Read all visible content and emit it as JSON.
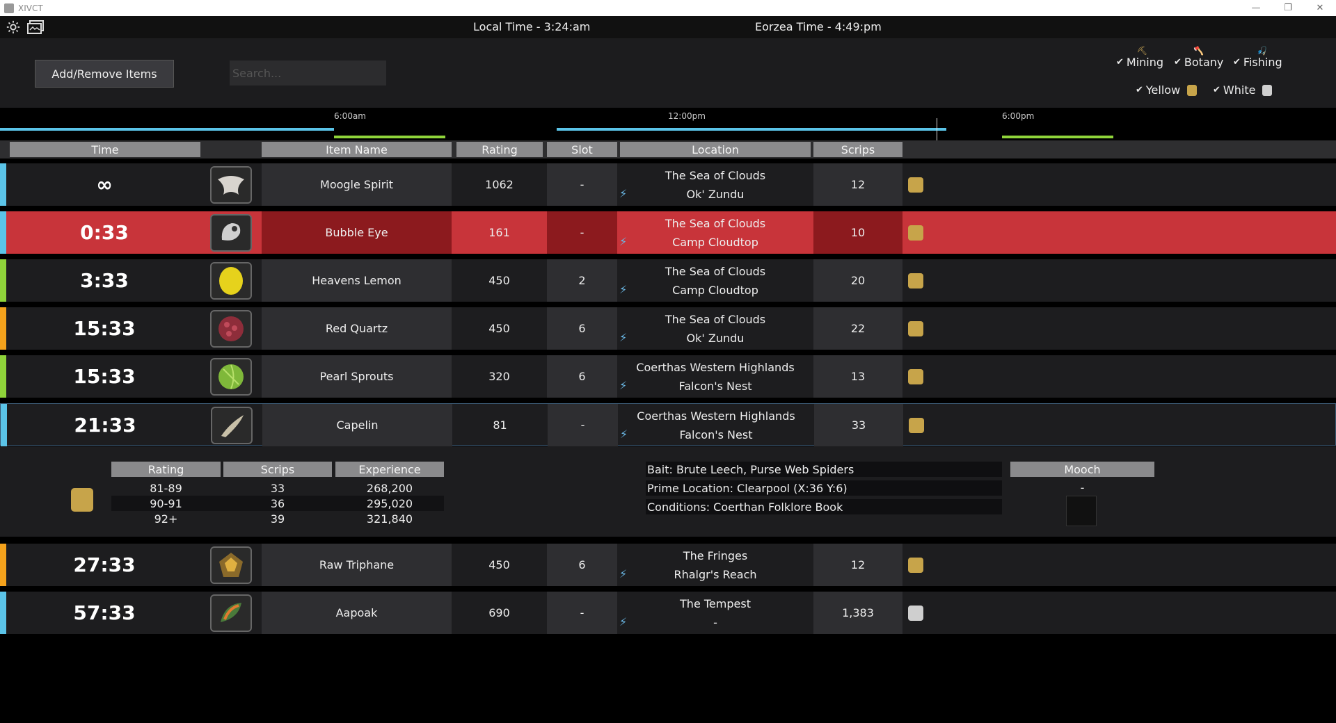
{
  "window": {
    "title": "XIVCT",
    "minimize": "—",
    "restore": "❐",
    "close": "✕"
  },
  "topbar": {
    "local_time": "Local Time - 3:24:am",
    "eorzea_time": "Eorzea Time - 4:49:pm"
  },
  "controls": {
    "add_remove_label": "Add/Remove Items",
    "search_placeholder": "Search...",
    "filters": {
      "mining": "Mining",
      "botany": "Botany",
      "fishing": "Fishing",
      "yellow": "Yellow",
      "white": "White"
    },
    "check": "✔"
  },
  "timeline": {
    "ticks": [
      "6:00am",
      "12:00pm",
      "6:00pm"
    ]
  },
  "columns": {
    "time": "Time",
    "item_name": "Item Name",
    "rating": "Rating",
    "slot": "Slot",
    "location": "Location",
    "scrips": "Scrips"
  },
  "colors": {
    "blue": "#5bc4e8",
    "green": "#8fd43a",
    "orange": "#f4a21c",
    "highlight_red": "#c8343a",
    "scrip_yellow": "#c7a44a",
    "scrip_white": "#cfcfcf"
  },
  "rows": [
    {
      "time": "∞",
      "name": "Moogle Spirit",
      "rating": "1062",
      "slot": "-",
      "region": "The Sea of Clouds",
      "place": "Ok' Zundu",
      "scrips": "12",
      "scrip_type": "yellow"
    },
    {
      "time": "0:33",
      "name": "Bubble Eye",
      "rating": "161",
      "slot": "-",
      "region": "The Sea of Clouds",
      "place": "Camp Cloudtop",
      "scrips": "10",
      "scrip_type": "yellow"
    },
    {
      "time": "3:33",
      "name": "Heavens Lemon",
      "rating": "450",
      "slot": "2",
      "region": "The Sea of Clouds",
      "place": "Camp Cloudtop",
      "scrips": "20",
      "scrip_type": "yellow"
    },
    {
      "time": "15:33",
      "name": "Red Quartz",
      "rating": "450",
      "slot": "6",
      "region": "The Sea of Clouds",
      "place": "Ok' Zundu",
      "scrips": "22",
      "scrip_type": "yellow"
    },
    {
      "time": "15:33",
      "name": "Pearl Sprouts",
      "rating": "320",
      "slot": "6",
      "region": "Coerthas Western Highlands",
      "place": "Falcon's Nest",
      "scrips": "13",
      "scrip_type": "yellow"
    },
    {
      "time": "21:33",
      "name": "Capelin",
      "rating": "81",
      "slot": "-",
      "region": "Coerthas Western Highlands",
      "place": "Falcon's Nest",
      "scrips": "33",
      "scrip_type": "yellow"
    },
    {
      "time": "27:33",
      "name": "Raw Triphane",
      "rating": "450",
      "slot": "6",
      "region": "The Fringes",
      "place": "Rhalgr's Reach",
      "scrips": "12",
      "scrip_type": "yellow"
    },
    {
      "time": "57:33",
      "name": "Aapoak",
      "rating": "690",
      "slot": "-",
      "region": "The Tempest",
      "place": "-",
      "scrips": "1,383",
      "scrip_type": "white"
    }
  ],
  "detail": {
    "headers": {
      "rating": "Rating",
      "scrips": "Scrips",
      "experience": "Experience",
      "mooch": "Mooch"
    },
    "tiers": [
      {
        "rating": "81-89",
        "scrips": "33",
        "experience": "268,200"
      },
      {
        "rating": "90-91",
        "scrips": "36",
        "experience": "295,020"
      },
      {
        "rating": "92+",
        "scrips": "39",
        "experience": "321,840"
      }
    ],
    "bait": "Bait: Brute Leech, Purse Web Spiders",
    "prime_location": "Prime Location: Clearpool (X:36 Y:6)",
    "conditions": "Conditions: Coerthan Folklore Book",
    "mooch_value": "-"
  }
}
